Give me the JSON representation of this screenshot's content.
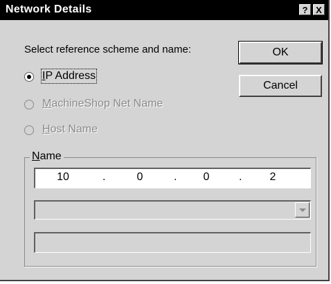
{
  "window": {
    "title": "Network Details",
    "help_label": "?",
    "close_label": "X"
  },
  "prompt": "Select reference scheme and name:",
  "buttons": {
    "ok": "OK",
    "cancel": "Cancel"
  },
  "radios": [
    {
      "accel": "I",
      "rest": "P Address",
      "selected": true,
      "enabled": true
    },
    {
      "accel": "M",
      "rest": "achineShop Net Name",
      "selected": false,
      "enabled": false
    },
    {
      "accel": "H",
      "rest": "ost Name",
      "selected": false,
      "enabled": false
    }
  ],
  "name_group": {
    "accel": "N",
    "rest": "ame",
    "ip_octets": [
      "10",
      "0",
      "0",
      "2"
    ],
    "separator": ".",
    "combo_value": "",
    "text_value": ""
  },
  "colors": {
    "face": "#d4d4d4",
    "titlebar": "#000000",
    "disabled_text": "#8a8a8a"
  }
}
